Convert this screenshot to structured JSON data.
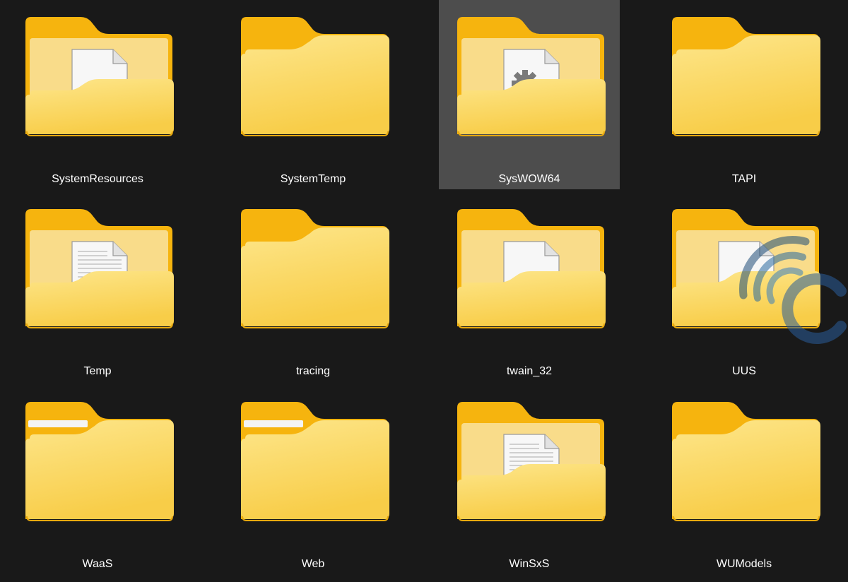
{
  "window": {
    "view": "large-icons"
  },
  "selected_item": "SysWOW64",
  "colors": {
    "background": "#191919",
    "selection": "#4d4d4d",
    "folder_back": "#f6b40e",
    "folder_front_top": "#fde68b",
    "folder_front_bottom": "#f8cd48",
    "label": "#ffffff"
  },
  "items": [
    {
      "name": "SystemResources",
      "preview": "document-icon"
    },
    {
      "name": "SystemTemp",
      "preview": "none"
    },
    {
      "name": "SysWOW64",
      "preview": "settings-document-icon"
    },
    {
      "name": "TAPI",
      "preview": "none"
    },
    {
      "name": "Temp",
      "preview": "text-document-icon"
    },
    {
      "name": "tracing",
      "preview": "none"
    },
    {
      "name": "twain_32",
      "preview": "document-icon"
    },
    {
      "name": "UUS",
      "preview": "document-icon"
    },
    {
      "name": "WaaS",
      "preview": "paper-sheet-icon"
    },
    {
      "name": "Web",
      "preview": "paper-sheet-icon"
    },
    {
      "name": "WinSxS",
      "preview": "text-document-icon"
    },
    {
      "name": "WUModels",
      "preview": "none"
    }
  ]
}
